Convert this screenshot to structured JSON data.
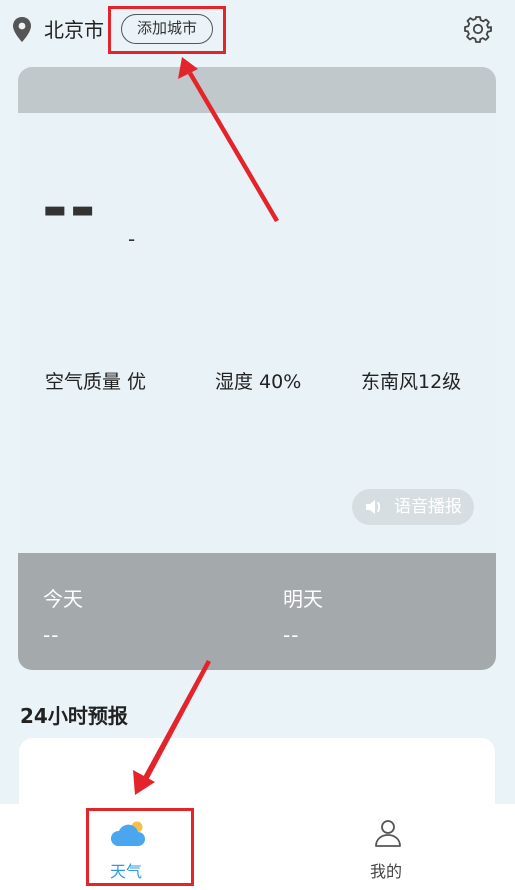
{
  "header": {
    "city": "北京市",
    "add_city_label": "添加城市",
    "location_icon": "location-pin-icon",
    "settings_icon": "gear-icon"
  },
  "weather": {
    "temperature": "--",
    "condition": "-",
    "air_quality": "空气质量  优",
    "humidity": "湿度  40%",
    "wind": "东南风12级",
    "voice_broadcast_label": "语音播报"
  },
  "forecast": {
    "today_label": "今天",
    "today_value": "--",
    "tomorrow_label": "明天",
    "tomorrow_value": "--"
  },
  "hourly": {
    "title": "24小时预报"
  },
  "bottom_nav": {
    "items": [
      {
        "label": "天气",
        "icon": "cloud-sun-icon",
        "active": true
      },
      {
        "label": "我的",
        "icon": "user-icon",
        "active": false
      }
    ]
  },
  "colors": {
    "background": "#eaf4f8",
    "accent": "#2f9ae6",
    "annotation": "#e3242b",
    "forecast_panel": "#a4a9ab"
  }
}
